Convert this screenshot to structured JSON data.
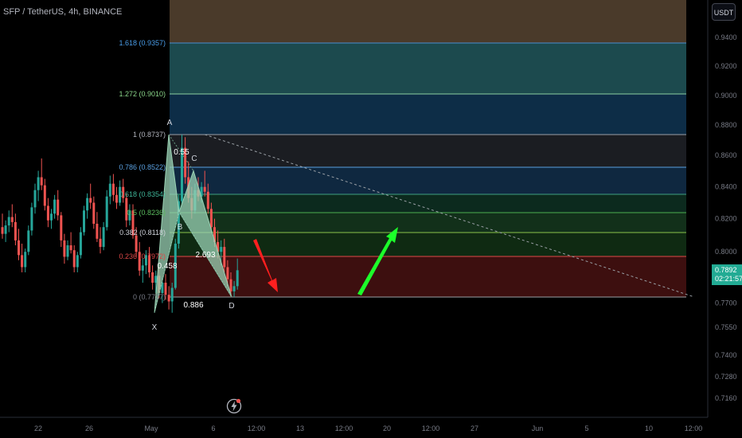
{
  "header": {
    "symbol": "SFP / TetherUS, 4h, BINANCE"
  },
  "currency": "USDT",
  "last_price": {
    "value": "0.7892",
    "countdown": "02:21:57",
    "color": "#22ab94"
  },
  "colors": {
    "background": "#000000",
    "up_candle": "#26a69a",
    "down_candle": "#ef5350",
    "pattern_fill": "#9ad1b4",
    "arrow_down": "#ff1f1f",
    "arrow_up": "#1cff2a",
    "axis_text": "#787b86"
  },
  "icons": {
    "bolt": "bolt-icon",
    "alert_dot": "alert-dot-icon"
  },
  "chart_data": {
    "type": "candlestick",
    "symbol": "SFP / TetherUS",
    "interval": "4h",
    "exchange": "BINANCE",
    "y_axis": {
      "ticks": [
        "0.9400",
        "0.9200",
        "0.9000",
        "0.8800",
        "0.8600",
        "0.8400",
        "0.8200",
        "0.8000",
        "0.7700",
        "0.7550",
        "0.7400",
        "0.7280",
        "0.7160"
      ],
      "ylim": [
        0.709,
        0.97
      ]
    },
    "x_axis": {
      "ticks": [
        "22",
        "26",
        "May",
        "6",
        "12:00",
        "13",
        "12:00",
        "20",
        "12:00",
        "27",
        "Jun",
        "5",
        "10",
        "12:00"
      ]
    },
    "fib_levels": [
      {
        "ratio": "",
        "price": 0.97,
        "label": "",
        "fill": "#4a3a2a",
        "line": "#4a3a2a"
      },
      {
        "ratio": "1.618",
        "price": 0.9357,
        "label": "1.618 (0.9357)",
        "fill": "#1c4a4e",
        "line": "#4a8fd0",
        "label_color": "#4a9eea"
      },
      {
        "ratio": "1.272",
        "price": 0.901,
        "label": "1.272 (0.9010)",
        "fill": "#0d2d47",
        "line": "#8bd0a0",
        "label_color": "#8ad68a"
      },
      {
        "ratio": "1",
        "price": 0.8737,
        "label": "1 (0.8737)",
        "fill": "#1b1d22",
        "line": "#9aa0a6",
        "label_color": "#b2b5be"
      },
      {
        "ratio": "0.786",
        "price": 0.8522,
        "label": "0.786 (0.8522)",
        "fill": "#0f2840",
        "line": "#5aa0e0",
        "label_color": "#5aa0e0"
      },
      {
        "ratio": "0.618",
        "price": 0.8354,
        "label": "0.618 (0.8354)",
        "fill": "#0c2a1e",
        "line": "#3f9f80",
        "label_color": "#3fb598"
      },
      {
        "ratio": "0.5",
        "price": 0.8236,
        "label": "0.5 (0.8236)",
        "fill": "#12301a",
        "line": "#4caf50",
        "label_color": "#5cbf60"
      },
      {
        "ratio": "0.382",
        "price": 0.8118,
        "label": "0.382 (0.8118)",
        "fill": "#0f2a12",
        "line": "#8bc34a",
        "label_color": "#d1d4dc"
      },
      {
        "ratio": "0.236",
        "price": 0.7972,
        "label": "0.236 (0.7972)",
        "fill": "#3d0f0f",
        "line": "#e04848",
        "label_color": "#e04848"
      },
      {
        "ratio": "0",
        "price": 0.7737,
        "label": "0 (0.7737)",
        "fill": "#3d0f0f",
        "line": "#9aa0a6",
        "label_color": "#787b86"
      }
    ],
    "harmonic_pattern": {
      "points": [
        {
          "name": "X",
          "x": 4,
          "y": 0.764
        },
        {
          "name": "A",
          "x": 5,
          "y": 0.8737
        },
        {
          "name": "B",
          "x": 8,
          "y": 0.824
        },
        {
          "name": "C",
          "x": 11,
          "y": 0.85
        },
        {
          "name": "D",
          "x": 19,
          "y": 0.7737
        }
      ],
      "ratios": [
        "0.55",
        "0.458",
        "2.693",
        "0.886"
      ]
    },
    "candles": [
      {
        "o": 0.815,
        "h": 0.823,
        "l": 0.808,
        "c": 0.811
      },
      {
        "o": 0.811,
        "h": 0.819,
        "l": 0.806,
        "c": 0.816
      },
      {
        "o": 0.816,
        "h": 0.825,
        "l": 0.812,
        "c": 0.821
      },
      {
        "o": 0.821,
        "h": 0.829,
        "l": 0.815,
        "c": 0.818
      },
      {
        "o": 0.818,
        "h": 0.823,
        "l": 0.804,
        "c": 0.807
      },
      {
        "o": 0.807,
        "h": 0.814,
        "l": 0.795,
        "c": 0.798
      },
      {
        "o": 0.798,
        "h": 0.805,
        "l": 0.788,
        "c": 0.791
      },
      {
        "o": 0.791,
        "h": 0.802,
        "l": 0.788,
        "c": 0.8
      },
      {
        "o": 0.8,
        "h": 0.816,
        "l": 0.798,
        "c": 0.813
      },
      {
        "o": 0.813,
        "h": 0.83,
        "l": 0.81,
        "c": 0.827
      },
      {
        "o": 0.827,
        "h": 0.842,
        "l": 0.823,
        "c": 0.838
      },
      {
        "o": 0.838,
        "h": 0.85,
        "l": 0.831,
        "c": 0.846
      },
      {
        "o": 0.846,
        "h": 0.858,
        "l": 0.838,
        "c": 0.841
      },
      {
        "o": 0.841,
        "h": 0.845,
        "l": 0.825,
        "c": 0.828
      },
      {
        "o": 0.828,
        "h": 0.833,
        "l": 0.815,
        "c": 0.819
      },
      {
        "o": 0.819,
        "h": 0.826,
        "l": 0.814,
        "c": 0.823
      },
      {
        "o": 0.823,
        "h": 0.835,
        "l": 0.82,
        "c": 0.832
      },
      {
        "o": 0.832,
        "h": 0.838,
        "l": 0.819,
        "c": 0.822
      },
      {
        "o": 0.822,
        "h": 0.824,
        "l": 0.803,
        "c": 0.807
      },
      {
        "o": 0.807,
        "h": 0.811,
        "l": 0.793,
        "c": 0.797
      },
      {
        "o": 0.797,
        "h": 0.807,
        "l": 0.795,
        "c": 0.804
      },
      {
        "o": 0.804,
        "h": 0.812,
        "l": 0.799,
        "c": 0.801
      },
      {
        "o": 0.801,
        "h": 0.804,
        "l": 0.788,
        "c": 0.791
      },
      {
        "o": 0.791,
        "h": 0.8,
        "l": 0.788,
        "c": 0.798
      },
      {
        "o": 0.798,
        "h": 0.815,
        "l": 0.796,
        "c": 0.812
      },
      {
        "o": 0.812,
        "h": 0.828,
        "l": 0.81,
        "c": 0.825
      },
      {
        "o": 0.825,
        "h": 0.836,
        "l": 0.82,
        "c": 0.833
      },
      {
        "o": 0.833,
        "h": 0.842,
        "l": 0.826,
        "c": 0.83
      },
      {
        "o": 0.83,
        "h": 0.834,
        "l": 0.814,
        "c": 0.817
      },
      {
        "o": 0.817,
        "h": 0.824,
        "l": 0.806,
        "c": 0.808
      },
      {
        "o": 0.808,
        "h": 0.815,
        "l": 0.799,
        "c": 0.803
      },
      {
        "o": 0.803,
        "h": 0.818,
        "l": 0.801,
        "c": 0.815
      },
      {
        "o": 0.815,
        "h": 0.838,
        "l": 0.813,
        "c": 0.834
      },
      {
        "o": 0.834,
        "h": 0.847,
        "l": 0.829,
        "c": 0.842
      },
      {
        "o": 0.842,
        "h": 0.848,
        "l": 0.831,
        "c": 0.835
      },
      {
        "o": 0.835,
        "h": 0.84,
        "l": 0.826,
        "c": 0.83
      },
      {
        "o": 0.83,
        "h": 0.844,
        "l": 0.828,
        "c": 0.84
      },
      {
        "o": 0.84,
        "h": 0.845,
        "l": 0.83,
        "c": 0.833
      },
      {
        "o": 0.833,
        "h": 0.836,
        "l": 0.815,
        "c": 0.819
      },
      {
        "o": 0.819,
        "h": 0.829,
        "l": 0.816,
        "c": 0.825
      },
      {
        "o": 0.825,
        "h": 0.829,
        "l": 0.808,
        "c": 0.81
      },
      {
        "o": 0.81,
        "h": 0.815,
        "l": 0.797,
        "c": 0.8
      },
      {
        "o": 0.8,
        "h": 0.806,
        "l": 0.786,
        "c": 0.789
      },
      {
        "o": 0.789,
        "h": 0.796,
        "l": 0.782,
        "c": 0.792
      },
      {
        "o": 0.792,
        "h": 0.801,
        "l": 0.787,
        "c": 0.798
      },
      {
        "o": 0.798,
        "h": 0.803,
        "l": 0.785,
        "c": 0.788
      },
      {
        "o": 0.788,
        "h": 0.792,
        "l": 0.778,
        "c": 0.782
      },
      {
        "o": 0.782,
        "h": 0.789,
        "l": 0.776,
        "c": 0.786
      },
      {
        "o": 0.786,
        "h": 0.791,
        "l": 0.773,
        "c": 0.776
      },
      {
        "o": 0.776,
        "h": 0.785,
        "l": 0.77,
        "c": 0.782
      },
      {
        "o": 0.782,
        "h": 0.787,
        "l": 0.772,
        "c": 0.775
      },
      {
        "o": 0.775,
        "h": 0.78,
        "l": 0.766,
        "c": 0.771
      },
      {
        "o": 0.771,
        "h": 0.782,
        "l": 0.764,
        "c": 0.779
      },
      {
        "o": 0.779,
        "h": 0.808,
        "l": 0.778,
        "c": 0.805
      },
      {
        "o": 0.805,
        "h": 0.835,
        "l": 0.802,
        "c": 0.831
      },
      {
        "o": 0.831,
        "h": 0.8737,
        "l": 0.829,
        "c": 0.865
      },
      {
        "o": 0.865,
        "h": 0.872,
        "l": 0.842,
        "c": 0.846
      },
      {
        "o": 0.846,
        "h": 0.856,
        "l": 0.83,
        "c": 0.833
      },
      {
        "o": 0.833,
        "h": 0.84,
        "l": 0.82,
        "c": 0.825
      },
      {
        "o": 0.825,
        "h": 0.842,
        "l": 0.823,
        "c": 0.838
      },
      {
        "o": 0.838,
        "h": 0.846,
        "l": 0.831,
        "c": 0.834
      },
      {
        "o": 0.834,
        "h": 0.843,
        "l": 0.83,
        "c": 0.84
      },
      {
        "o": 0.84,
        "h": 0.85,
        "l": 0.834,
        "c": 0.837
      },
      {
        "o": 0.837,
        "h": 0.842,
        "l": 0.823,
        "c": 0.826
      },
      {
        "o": 0.826,
        "h": 0.83,
        "l": 0.812,
        "c": 0.815
      },
      {
        "o": 0.815,
        "h": 0.82,
        "l": 0.803,
        "c": 0.806
      },
      {
        "o": 0.806,
        "h": 0.813,
        "l": 0.796,
        "c": 0.8
      },
      {
        "o": 0.8,
        "h": 0.807,
        "l": 0.792,
        "c": 0.803
      },
      {
        "o": 0.803,
        "h": 0.808,
        "l": 0.788,
        "c": 0.791
      },
      {
        "o": 0.791,
        "h": 0.795,
        "l": 0.78,
        "c": 0.784
      },
      {
        "o": 0.784,
        "h": 0.788,
        "l": 0.774,
        "c": 0.777
      },
      {
        "o": 0.777,
        "h": 0.783,
        "l": 0.7737,
        "c": 0.78
      },
      {
        "o": 0.78,
        "h": 0.796,
        "l": 0.778,
        "c": 0.7892
      }
    ],
    "trendline": {
      "from": {
        "index": 62,
        "y": 0.8737
      },
      "to": {
        "index": 212,
        "y": 0.7737
      }
    }
  }
}
